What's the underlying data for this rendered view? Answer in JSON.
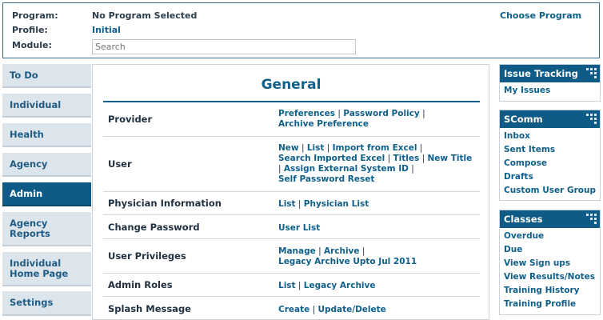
{
  "header": {
    "program_label": "Program:",
    "program_value": "No Program Selected",
    "profile_label": "Profile:",
    "profile_value": "Initial",
    "module_label": "Module:",
    "search_placeholder": "Search",
    "choose_program": "Choose Program"
  },
  "leftnav": {
    "items": [
      {
        "label": "To Do"
      },
      {
        "label": "Individual"
      },
      {
        "label": "Health"
      },
      {
        "label": "Agency"
      },
      {
        "label": "Admin"
      },
      {
        "label": "Agency Reports"
      },
      {
        "label": "Individual Home Page"
      },
      {
        "label": "Settings"
      }
    ],
    "active": "Admin"
  },
  "main": {
    "title": "General",
    "rows": [
      {
        "label": "Provider",
        "links": [
          "Preferences",
          "Password Policy",
          "Archive Preference"
        ]
      },
      {
        "label": "User",
        "links": [
          "New",
          "List",
          "Import from Excel",
          "Search Imported Excel",
          "Titles",
          "New Title",
          "Assign External System ID",
          "Self Password Reset"
        ]
      },
      {
        "label": "Physician Information",
        "links": [
          "List",
          "Physician List"
        ]
      },
      {
        "label": "Change Password",
        "links": [
          "User List"
        ]
      },
      {
        "label": "User Privileges",
        "links": [
          "Manage",
          "Archive",
          "Legacy Archive Upto Jul 2011"
        ]
      },
      {
        "label": "Admin Roles",
        "links": [
          "List",
          "Legacy Archive"
        ]
      },
      {
        "label": "Splash Message",
        "links": [
          "Create",
          "Update/Delete"
        ]
      }
    ]
  },
  "right": {
    "issue_tracking": {
      "title": "Issue Tracking",
      "items": [
        "My Issues"
      ]
    },
    "scomm": {
      "title": "SComm",
      "items": [
        "Inbox",
        "Sent Items",
        "Compose",
        "Drafts",
        "Custom User Group"
      ]
    },
    "classes": {
      "title": "Classes",
      "items": [
        "Overdue",
        "Due",
        "View Sign ups",
        "View Results/Notes",
        "Training History",
        "Training Profile"
      ]
    }
  },
  "colors": {
    "accent": "#0f5b87",
    "link": "#0e5f8a",
    "nav_bg": "#dde5ec"
  },
  "icons": {
    "panel_grip": "grip-dots-icon"
  }
}
